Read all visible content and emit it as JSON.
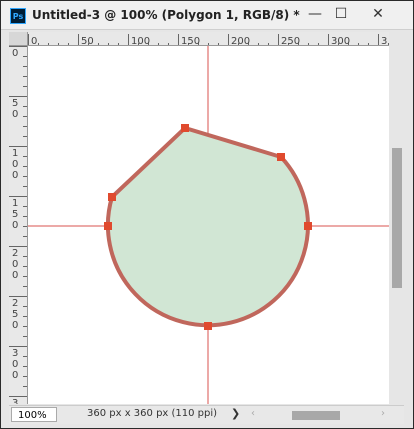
{
  "window": {
    "title": "Untitled-3 @ 100% (Polygon 1, RGB/8) *",
    "app_icon": "Ps",
    "minimize_glyph": "—",
    "maximize_glyph": "☐",
    "close_glyph": "✕"
  },
  "rulers": {
    "horizontal_labels": [
      "0",
      "50",
      "100",
      "150",
      "200",
      "250",
      "300",
      "3"
    ],
    "vertical_labels": [
      "0",
      "50",
      "100",
      "150",
      "200",
      "250",
      "300",
      "3"
    ]
  },
  "status": {
    "zoom": "100%",
    "doc_info": "360 px x 360 px (110 ppi)",
    "arrow_glyph": "❯",
    "scroll_left_glyph": "‹",
    "scroll_right_glyph": "›"
  },
  "colors": {
    "shape_fill": "#d1e6d4",
    "shape_stroke": "#c0675c",
    "guide": "#d9534f",
    "anchor": "#e04a2e"
  }
}
